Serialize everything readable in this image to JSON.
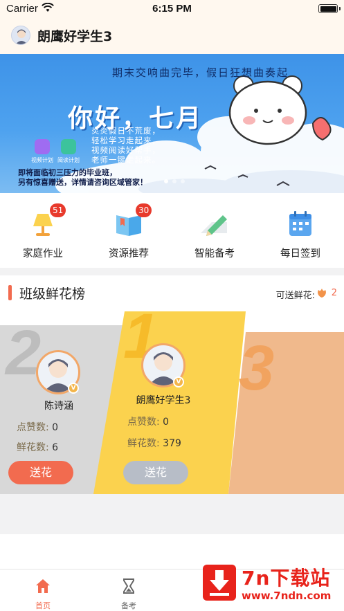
{
  "status_bar": {
    "carrier": "Carrier",
    "time": "6:15 PM"
  },
  "header": {
    "user_name": "朗鹰好学生3"
  },
  "banner": {
    "top_line": "期末交响曲完毕，假日狂想曲奏起",
    "hello": "你好，七月",
    "slogan_lines": [
      "炎炎假日不荒废，",
      "轻松学习走起来，",
      "视频阅读好帮手，",
      "老师一键走起来。"
    ],
    "promo_lines": [
      "即将面临初三压力的毕业班，",
      "另有惊喜赠送，详情请咨询区域管家！"
    ],
    "mini_apps": [
      "视频计划",
      "阅读计划"
    ],
    "page_count": 3,
    "active_page": 1
  },
  "quick_menu": [
    {
      "label": "家庭作业",
      "badge": "51",
      "icon": "lamp-icon"
    },
    {
      "label": "资源推荐",
      "badge": "30",
      "icon": "book-icon"
    },
    {
      "label": "智能备考",
      "badge": "",
      "icon": "pencil-icon"
    },
    {
      "label": "每日签到",
      "badge": "",
      "icon": "calendar-icon"
    }
  ],
  "ranking": {
    "title": "班级鲜花榜",
    "flowers_label": "可送鲜花:",
    "flowers_count": "2",
    "ranks": [
      "1",
      "2",
      "3"
    ],
    "candidates": [
      {
        "rank": "2",
        "name": "陈诗涵",
        "likes_label": "点赞数:",
        "likes": "0",
        "flowers_label": "鲜花数:",
        "flowers": "6",
        "button": "送花"
      },
      {
        "rank": "1",
        "name": "朗鹰好学生3",
        "likes_label": "点赞数:",
        "likes": "0",
        "flowers_label": "鲜花数:",
        "flowers": "379",
        "button": "送花"
      }
    ],
    "verified_badge": "V"
  },
  "tab_bar": [
    {
      "label": "首页",
      "icon": "home-icon",
      "active": true
    },
    {
      "label": "备考",
      "icon": "hourglass-icon",
      "active": false
    }
  ],
  "watermark": {
    "title": "7n下载站",
    "url": "www.7ndn.com"
  },
  "colors": {
    "accent": "#f26b4f",
    "gold": "#fbd24e",
    "peach": "#f0b98c",
    "silver": "#d8d8d8",
    "banner_blue": "#3e93e8",
    "badge_red": "#e83a2c"
  }
}
